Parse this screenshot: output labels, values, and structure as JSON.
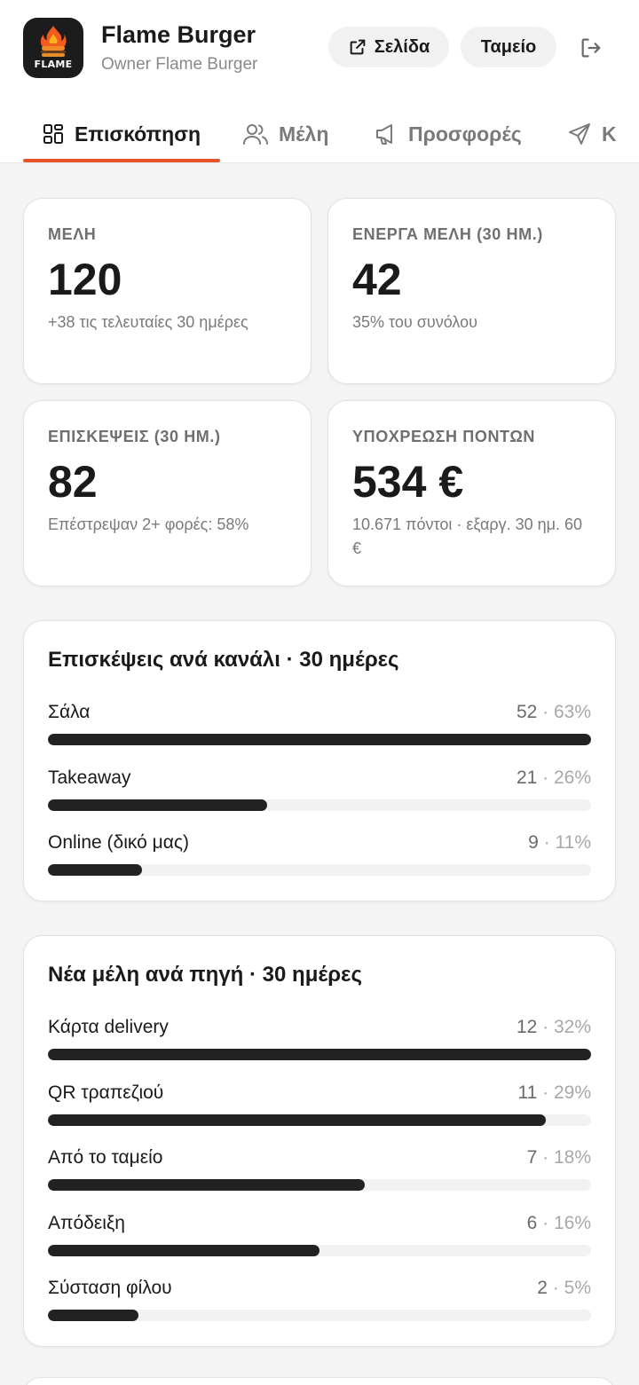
{
  "brand": {
    "logo_text": "FLAME",
    "name": "Flame Burger",
    "subtitle": "Owner Flame Burger"
  },
  "actions": {
    "page_label": "Σελίδα",
    "cash_label": "Ταμείο"
  },
  "tabs": [
    {
      "label": "Επισκόπηση",
      "icon": "grid-icon",
      "active": true
    },
    {
      "label": "Μέλη",
      "icon": "users-icon",
      "active": false
    },
    {
      "label": "Προσφορές",
      "icon": "megaphone-icon",
      "active": false
    },
    {
      "label": "Κ",
      "icon": "send-icon",
      "active": false
    }
  ],
  "accent_color": "#e8552c",
  "stats": [
    {
      "label": "ΜΕΛΗ",
      "value": "120",
      "sub": "+38 τις τελευταίες 30 ημέρες"
    },
    {
      "label": "ΕΝΕΡΓΑ ΜΕΛΗ (30 ΗΜ.)",
      "value": "42",
      "sub": "35% του συνόλου"
    },
    {
      "label": "ΕΠΙΣΚΕΨΕΙΣ (30 ΗΜ.)",
      "value": "82",
      "sub": "Επέστρεψαν 2+ φορές: 58%"
    },
    {
      "label": "ΥΠΟΧΡΕΩΣΗ ΠΟΝΤΩΝ",
      "value": "534 €",
      "sub": "10.671 πόντοι · εξαργ. 30 ημ. 60 €"
    }
  ],
  "visits_by_channel": {
    "title": "Επισκέψεις ανά κανάλι · 30 ημέρες",
    "rows": [
      {
        "label": "Σάλα",
        "count": "52",
        "pct": "63%",
        "share": 1.0
      },
      {
        "label": "Takeaway",
        "count": "21",
        "pct": "26%",
        "share": 0.404
      },
      {
        "label": "Online (δικό μας)",
        "count": "9",
        "pct": "11%",
        "share": 0.173
      }
    ]
  },
  "new_members_by_source": {
    "title": "Νέα μέλη ανά πηγή · 30 ημέρες",
    "rows": [
      {
        "label": "Κάρτα delivery",
        "count": "12",
        "pct": "32%",
        "share": 1.0
      },
      {
        "label": "QR τραπεζιού",
        "count": "11",
        "pct": "29%",
        "share": 0.917
      },
      {
        "label": "Από το ταμείο",
        "count": "7",
        "pct": "18%",
        "share": 0.583
      },
      {
        "label": "Απόδειξη",
        "count": "6",
        "pct": "16%",
        "share": 0.5
      },
      {
        "label": "Σύσταση φίλου",
        "count": "2",
        "pct": "5%",
        "share": 0.167
      }
    ]
  }
}
